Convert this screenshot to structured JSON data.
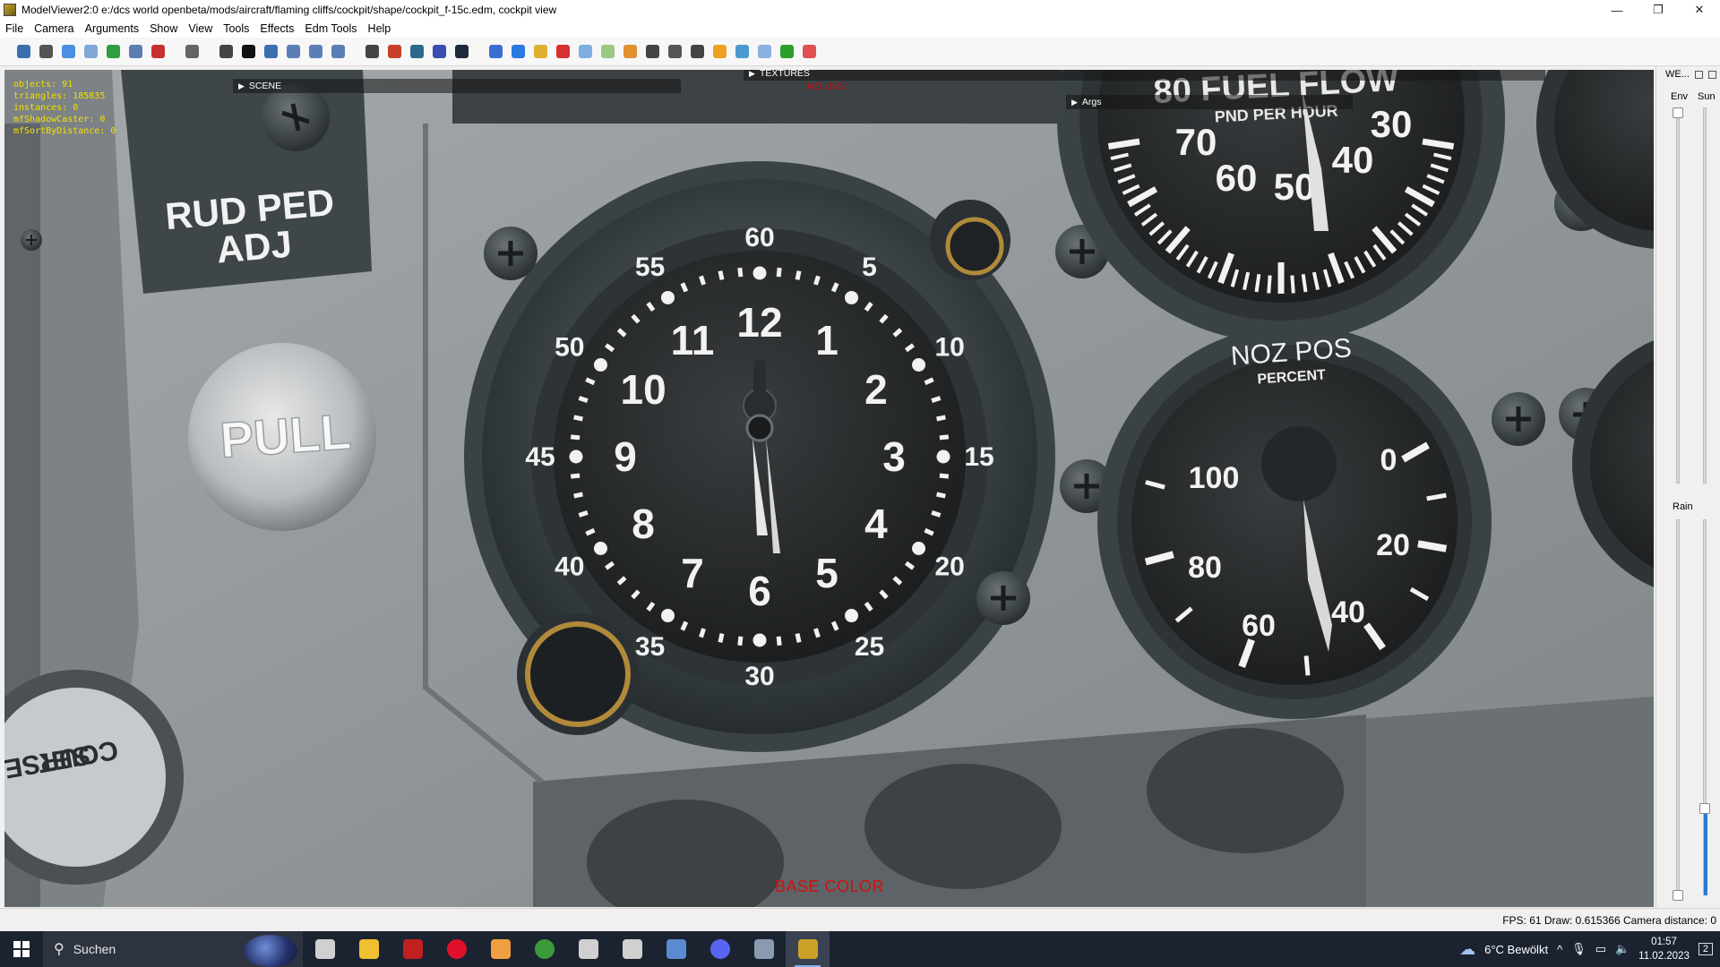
{
  "window": {
    "title": "ModelViewer2:0 e:/dcs world openbeta/mods/aircraft/flaming cliffs/cockpit/shape/cockpit_f-15c.edm, cockpit view",
    "controls": [
      "—",
      "❐",
      "✕"
    ]
  },
  "menu": [
    "File",
    "Camera",
    "Arguments",
    "Show",
    "View",
    "Tools",
    "Effects",
    "Edm Tools",
    "Help"
  ],
  "toolbar": {
    "icons": [
      {
        "name": "save-icon",
        "color": "#3a6fb0"
      },
      {
        "name": "open-model-icon",
        "color": "#555555"
      },
      {
        "name": "sphere-icon",
        "color": "#4a8fe0"
      },
      {
        "name": "refresh-icon",
        "color": "#7fa8d8"
      },
      {
        "name": "reload-green-icon",
        "color": "#2e9e3e"
      },
      {
        "name": "image-icon",
        "color": "#5b7fb5"
      },
      {
        "name": "pdf-icon",
        "color": "#c83030"
      },
      {
        "name": "sep",
        "color": ""
      },
      {
        "name": "camera-icon",
        "color": "#666666"
      },
      {
        "name": "sep",
        "color": ""
      },
      {
        "name": "axis-icon",
        "color": "#444444"
      },
      {
        "name": "grid-black-icon",
        "color": "#111111"
      },
      {
        "name": "funnel-icon",
        "color": "#3a6fb0"
      },
      {
        "name": "cone-icon",
        "color": "#5b7fb5"
      },
      {
        "name": "arrow-right-icon",
        "color": "#5b7fb5"
      },
      {
        "name": "speaker-icon",
        "color": "#5b7fb5"
      },
      {
        "name": "sep",
        "color": ""
      },
      {
        "name": "layer-icon",
        "color": "#444444"
      },
      {
        "name": "palette-icon",
        "color": "#c8402a"
      },
      {
        "name": "monitor-icon",
        "color": "#2a6a8a"
      },
      {
        "name": "undo-icon",
        "color": "#3a4fb0"
      },
      {
        "name": "eye-icon",
        "color": "#1e2a3a"
      },
      {
        "name": "sep",
        "color": ""
      },
      {
        "name": "chart-icon",
        "color": "#3a6fd0"
      },
      {
        "name": "cube-blue-icon",
        "color": "#2a7ae0"
      },
      {
        "name": "folders-icon",
        "color": "#e0b030"
      },
      {
        "name": "cube-red-icon",
        "color": "#d83030"
      },
      {
        "name": "box-icon",
        "color": "#7faee0"
      },
      {
        "name": "shape-green-icon",
        "color": "#9ac880"
      },
      {
        "name": "graph-icon",
        "color": "#e09030"
      },
      {
        "name": "figure-icon",
        "color": "#444444"
      },
      {
        "name": "stack-icon",
        "color": "#555555"
      },
      {
        "name": "car-icon",
        "color": "#444444"
      },
      {
        "name": "ball-orange-icon",
        "color": "#f0a020"
      },
      {
        "name": "snowflake-icon",
        "color": "#4a9ad0"
      },
      {
        "name": "grid-blue-icon",
        "color": "#8ab0e0"
      },
      {
        "name": "grid-green-icon",
        "color": "#2aa02a"
      },
      {
        "name": "target-icon",
        "color": "#e05050"
      }
    ]
  },
  "viewport": {
    "stats": [
      "objects: 91",
      "triangles: 185835",
      "instances: 0",
      "mfShadowCaster: 0",
      "mfSortByDistance: 0"
    ],
    "panels": {
      "scene": "SCENE",
      "textures": "TEXTURES",
      "args": "Args"
    },
    "overlay_top": "NO UVS",
    "overlay_bottom": "BASE COLOR",
    "cockpit": {
      "rud_ped_line1": "RUD  PED",
      "rud_ped_line2": "ADJ",
      "pull": "PULL",
      "course_line1": "COURSE",
      "course_line2": "SET",
      "clock_hours": [
        "12",
        "1",
        "2",
        "3",
        "4",
        "5",
        "6",
        "7",
        "8",
        "9",
        "10",
        "11"
      ],
      "clock_minutes": [
        "60",
        "5",
        "10",
        "15",
        "20",
        "25",
        "30",
        "35",
        "40",
        "45",
        "50",
        "55"
      ],
      "fuel_title": "80 FUEL  FLOW",
      "fuel_sub": "PND PER HOUR",
      "fuel_nums": [
        "70",
        "60",
        "50",
        "40",
        "30"
      ],
      "noz_title": "NOZ POS",
      "noz_sub": "PERCENT",
      "noz_nums": [
        "0",
        "20",
        "40",
        "60",
        "80",
        "100"
      ]
    }
  },
  "sidepanel": {
    "title": "WE...",
    "env": "Env",
    "sun": "Sun",
    "rain": "Rain"
  },
  "status": {
    "text": "FPS: 61  Draw: 0.615366  Camera distance: 0"
  },
  "taskbar": {
    "search": "Suchen",
    "apps": [
      {
        "name": "task-view-icon",
        "color": "#d0d0d0"
      },
      {
        "name": "file-explorer-icon",
        "color": "#f0c030"
      },
      {
        "name": "red-app-icon",
        "color": "#c02020"
      },
      {
        "name": "opera-icon",
        "color": "#e0102a"
      },
      {
        "name": "media-player-icon",
        "color": "#f0a040"
      },
      {
        "name": "xbox-icon",
        "color": "#3a9a3a"
      },
      {
        "name": "settings-icon",
        "color": "#d0d0d0"
      },
      {
        "name": "headset-icon",
        "color": "#d0d0d0"
      },
      {
        "name": "notepad-icon",
        "color": "#5a8ad0"
      },
      {
        "name": "discord-icon",
        "color": "#5865f2"
      },
      {
        "name": "dcs-icon",
        "color": "#8a9ab0"
      },
      {
        "name": "modelviewer-icon",
        "color": "#c9a227"
      }
    ],
    "weather": "6°C  Bewölkt",
    "time": "01:57",
    "date": "11.02.2023",
    "notifications": "2"
  }
}
